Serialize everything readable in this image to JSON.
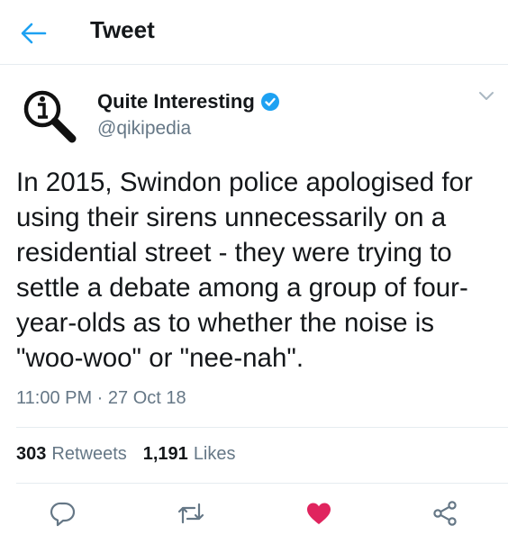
{
  "header": {
    "title": "Tweet",
    "back_icon": "back-arrow-icon"
  },
  "author": {
    "name": "Quite Interesting",
    "handle": "@qikipedia",
    "verified_icon": "verified-badge-icon",
    "avatar_icon": "magnifying-glass-i-icon"
  },
  "tweet": {
    "text": "In 2015, Swindon police apologised for using their sirens unnecessarily on a residential street - they were trying to settle a debate among a group of four-year-olds as to whether the noise is \"woo-woo\" or \"nee-nah\".",
    "timestamp": "11:00 PM · 27 Oct 18"
  },
  "stats": {
    "retweets_count": "303",
    "retweets_label": "Retweets",
    "likes_count": "1,191",
    "likes_label": "Likes"
  },
  "actions": [
    "reply-icon",
    "retweet-icon",
    "like-icon",
    "share-icon"
  ],
  "colors": {
    "accent": "#1da1f2",
    "like": "#e0245e",
    "secondary_text": "#657786"
  }
}
